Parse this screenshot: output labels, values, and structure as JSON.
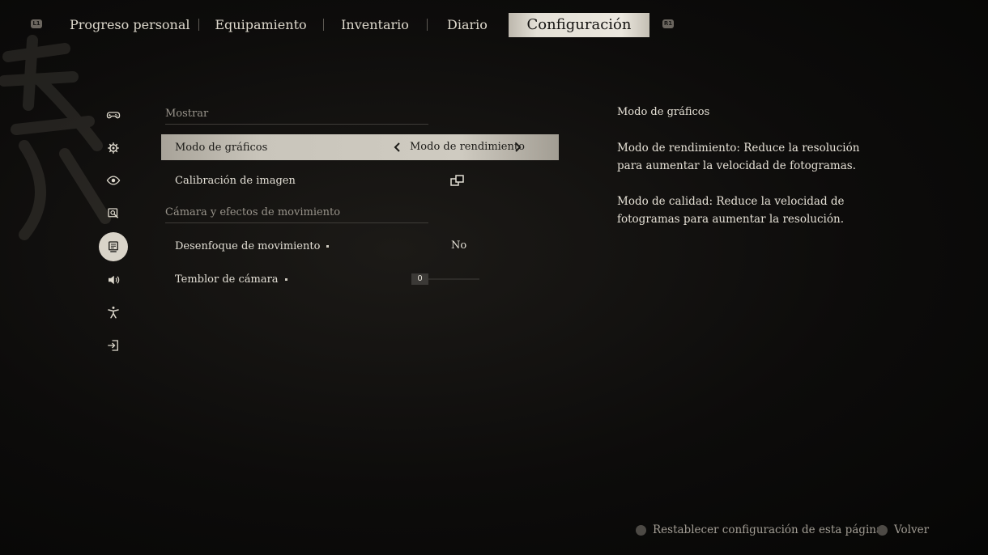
{
  "tabs": {
    "left_bumper": "L1",
    "right_bumper": "R1",
    "items": [
      {
        "label": "Progreso personal"
      },
      {
        "label": "Equipamiento"
      },
      {
        "label": "Inventario"
      },
      {
        "label": "Diario"
      },
      {
        "label": "Configuración",
        "active": true
      }
    ]
  },
  "rail": {
    "icons": [
      {
        "name": "gamepad-icon"
      },
      {
        "name": "gear-icon"
      },
      {
        "name": "eye-icon"
      },
      {
        "name": "magnifier-icon"
      },
      {
        "name": "display-icon",
        "active": true
      },
      {
        "name": "speaker-icon"
      },
      {
        "name": "accessibility-icon"
      },
      {
        "name": "exit-icon"
      }
    ]
  },
  "sections": {
    "display_title": "Mostrar",
    "camera_title": "Cámara y efectos de movimiento"
  },
  "settings": {
    "graphics_mode": {
      "label": "Modo de gráficos",
      "value": "Modo de rendimiento"
    },
    "image_calibration": {
      "label": "Calibración de imagen"
    },
    "motion_blur": {
      "label": "Desenfoque de movimiento",
      "value": "No"
    },
    "camera_shake": {
      "label": "Temblor de cámara",
      "value": "0"
    }
  },
  "description": {
    "title": "Modo de gráficos",
    "para1": "Modo de rendimiento: Reduce la resolución para aumentar la velocidad de fotogramas.",
    "para2": "Modo de calidad: Reduce la velocidad de fotogramas para aumentar la resolución."
  },
  "footer": {
    "reset_label": "Restablecer configuración de esta página",
    "back_label": "Volver"
  },
  "colors": {
    "active_tab_bg": "#e4e0d7",
    "selected_row_bg": "#c9c5bb",
    "text_primary": "#e6e1d6",
    "text_muted": "#99948b"
  }
}
